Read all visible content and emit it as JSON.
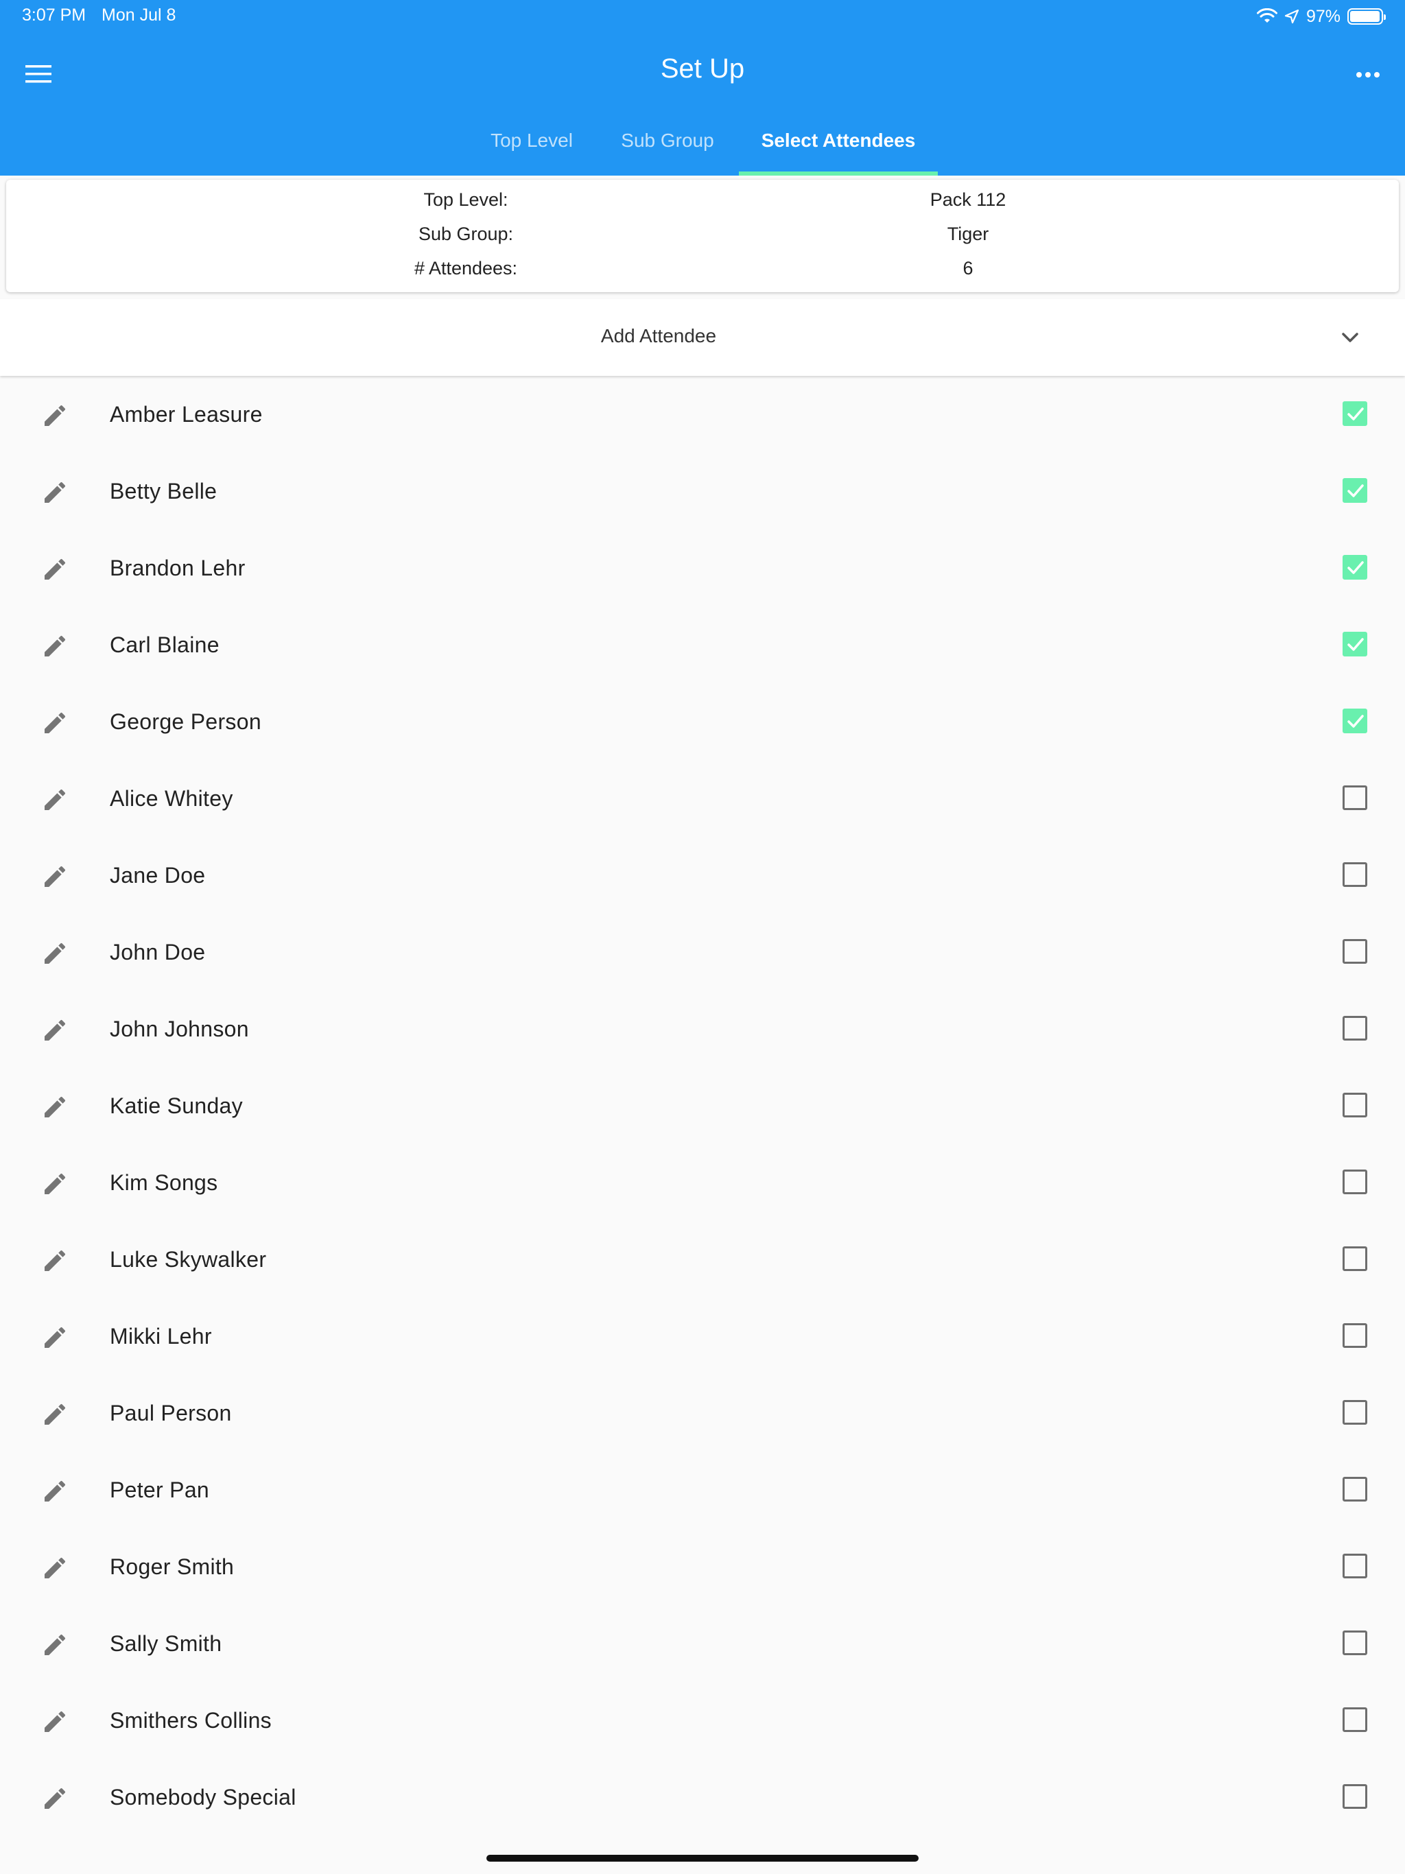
{
  "status_bar": {
    "time": "3:07 PM",
    "date": "Mon Jul 8",
    "battery": "97%",
    "battery_level": 0.97
  },
  "app_bar": {
    "title": "Set Up",
    "menu_icon": "hamburger-menu-icon",
    "more_icon": "more-horizontal-icon"
  },
  "tabs": [
    {
      "label": "Top Level",
      "active": false
    },
    {
      "label": "Sub Group",
      "active": false
    },
    {
      "label": "Select Attendees",
      "active": true
    }
  ],
  "summary": {
    "top_level_label": "Top Level:",
    "top_level_value": "Pack 112",
    "sub_group_label": "Sub Group:",
    "sub_group_value": "Tiger",
    "attendees_label": "# Attendees:",
    "attendees_value": "6"
  },
  "add_attendee": {
    "label": "Add Attendee",
    "icon": "chevron-down-icon"
  },
  "colors": {
    "primary": "#2196f3",
    "accent": "#69f0ae",
    "icon_gray": "#757575"
  },
  "attendees": [
    {
      "name": "Amber Leasure",
      "checked": true
    },
    {
      "name": "Betty Belle",
      "checked": true
    },
    {
      "name": "Brandon Lehr",
      "checked": true
    },
    {
      "name": "Carl Blaine",
      "checked": true
    },
    {
      "name": "George Person",
      "checked": true
    },
    {
      "name": "Alice Whitey",
      "checked": false
    },
    {
      "name": "Jane Doe",
      "checked": false
    },
    {
      "name": "John Doe",
      "checked": false
    },
    {
      "name": "John Johnson",
      "checked": false
    },
    {
      "name": "Katie Sunday",
      "checked": false
    },
    {
      "name": "Kim Songs",
      "checked": false
    },
    {
      "name": "Luke Skywalker",
      "checked": false
    },
    {
      "name": "Mikki Lehr",
      "checked": false
    },
    {
      "name": "Paul Person",
      "checked": false
    },
    {
      "name": "Peter Pan",
      "checked": false
    },
    {
      "name": "Roger Smith",
      "checked": false
    },
    {
      "name": "Sally Smith",
      "checked": false
    },
    {
      "name": "Smithers Collins",
      "checked": false
    },
    {
      "name": "Somebody Special",
      "checked": false
    }
  ]
}
